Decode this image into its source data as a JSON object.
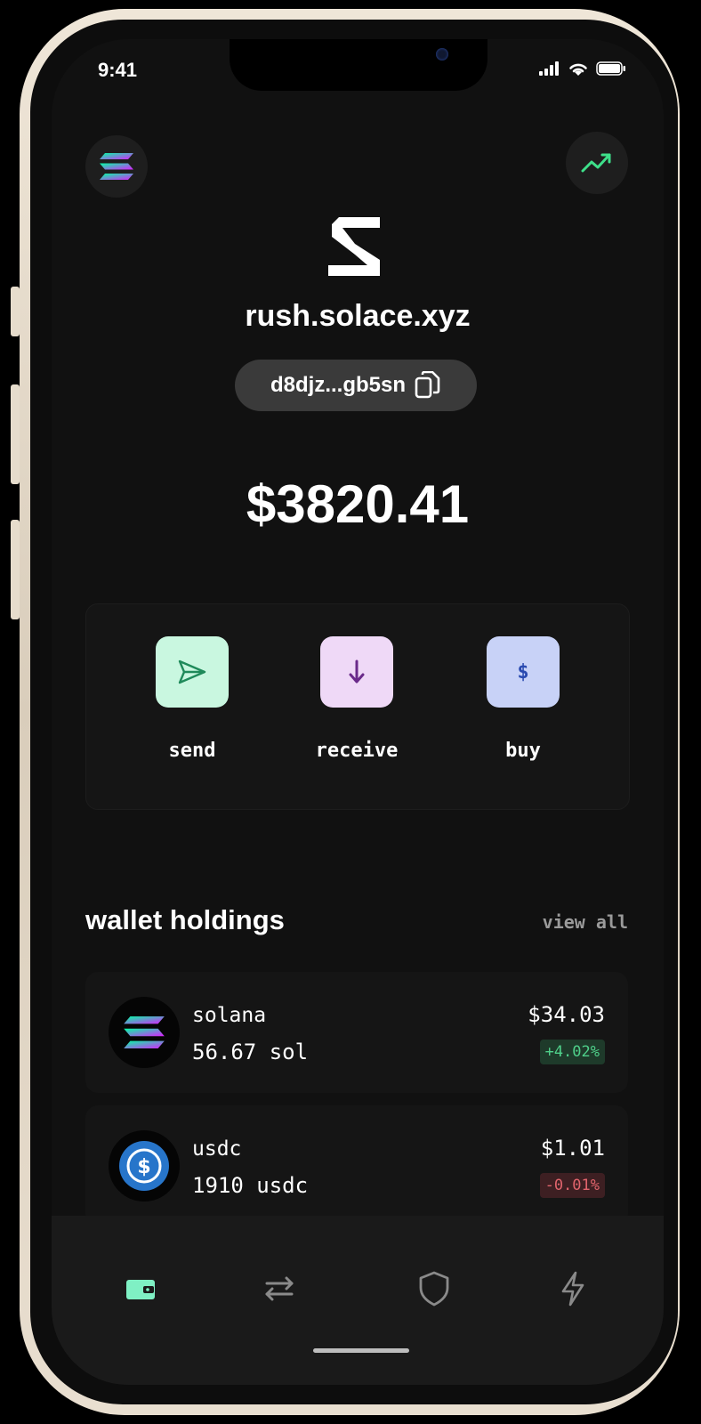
{
  "status_bar": {
    "time": "9:41"
  },
  "profile": {
    "username": "rush.solace.xyz",
    "address_short": "d8djz...gb5sn"
  },
  "balance": "$3820.41",
  "actions": [
    {
      "label": "send",
      "icon": "send-icon",
      "color": "#c9f7e0",
      "icon_color": "#1f8a5a"
    },
    {
      "label": "receive",
      "icon": "arrow-down-icon",
      "color": "#efd9f7",
      "icon_color": "#6a2a8a"
    },
    {
      "label": "buy",
      "icon": "dollar-icon",
      "color": "#c8d2f7",
      "icon_color": "#2a4ab0"
    }
  ],
  "holdings_section": {
    "title": "wallet holdings",
    "view_all_label": "view all"
  },
  "holdings": [
    {
      "name": "solana",
      "amount": "56.67 sol",
      "price": "$34.03",
      "change": "+4.02%",
      "direction": "up",
      "icon": "solana-icon"
    },
    {
      "name": "usdc",
      "amount": "1910 usdc",
      "price": "$1.01",
      "change": "-0.01%",
      "direction": "down",
      "icon": "usdc-icon"
    }
  ],
  "nav": [
    {
      "icon": "wallet-icon",
      "active": true
    },
    {
      "icon": "swap-icon",
      "active": false
    },
    {
      "icon": "shield-icon",
      "active": false
    },
    {
      "icon": "lightning-icon",
      "active": false
    }
  ],
  "colors": {
    "accent": "#7ff0c4",
    "up": "#4fd08a",
    "down": "#e0646c",
    "chart_icon": "#3ee08a"
  }
}
